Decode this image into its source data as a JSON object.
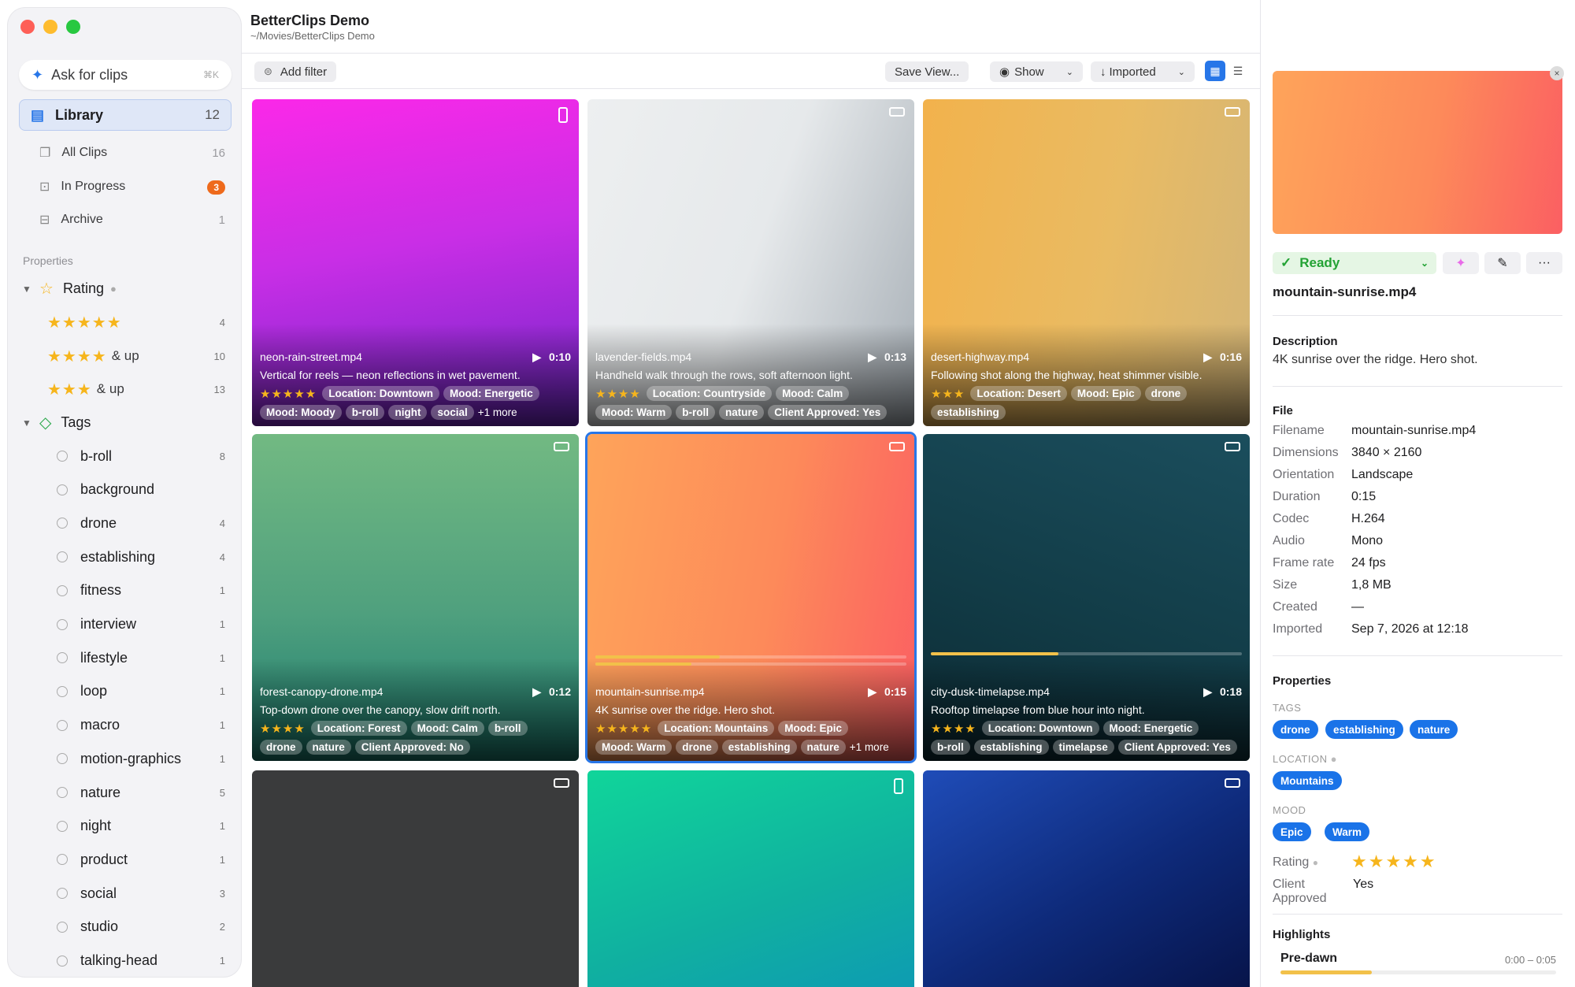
{
  "window": {
    "title": "BetterClips Demo",
    "path": "~/Movies/BetterClips Demo"
  },
  "sidebar": {
    "ask": {
      "label": "Ask for clips",
      "shortcut": "⌘K"
    },
    "library": {
      "label": "Library",
      "count": "12"
    },
    "items": [
      {
        "label": "All Clips",
        "count": "16"
      },
      {
        "label": "In Progress",
        "count": "3"
      },
      {
        "label": "Archive",
        "count": "1"
      }
    ],
    "properties_label": "Properties",
    "rating": {
      "label": "Rating",
      "rows": [
        {
          "stars": "★★★★★",
          "suffix": "",
          "count": "4"
        },
        {
          "stars": "★★★★",
          "suffix": "& up",
          "count": "10"
        },
        {
          "stars": "★★★",
          "suffix": "& up",
          "count": "13"
        }
      ]
    },
    "tags": {
      "label": "Tags",
      "rows": [
        {
          "label": "b-roll",
          "count": "8"
        },
        {
          "label": "background",
          "count": ""
        },
        {
          "label": "drone",
          "count": "4"
        },
        {
          "label": "establishing",
          "count": "4"
        },
        {
          "label": "fitness",
          "count": "1"
        },
        {
          "label": "interview",
          "count": "1"
        },
        {
          "label": "lifestyle",
          "count": "1"
        },
        {
          "label": "loop",
          "count": "1"
        },
        {
          "label": "macro",
          "count": "1"
        },
        {
          "label": "motion-graphics",
          "count": "1"
        },
        {
          "label": "nature",
          "count": "5"
        },
        {
          "label": "night",
          "count": "1"
        },
        {
          "label": "product",
          "count": "1"
        },
        {
          "label": "social",
          "count": "3"
        },
        {
          "label": "studio",
          "count": "2"
        },
        {
          "label": "talking-head",
          "count": "1"
        }
      ]
    }
  },
  "toolbar": {
    "add_filter": "Add filter",
    "save_view": "Save View...",
    "show": "Show",
    "sort": "Imported"
  },
  "clips": [
    {
      "name": "neon-rain-street.mp4",
      "duration": "0:10",
      "description": "Vertical for reels — neon reflections in wet pavement.",
      "stars": "★★★★★",
      "chips": [
        "Location: Downtown",
        "Mood: Energetic",
        "Mood: Moody",
        "b-roll",
        "night",
        "social"
      ],
      "more": "+1 more"
    },
    {
      "name": "lavender-fields.mp4",
      "duration": "0:13",
      "description": "Handheld walk through the rows, soft afternoon light.",
      "stars": "★★★★",
      "chips": [
        "Location: Countryside",
        "Mood: Calm",
        "Mood: Warm",
        "b-roll",
        "nature",
        "Client Approved: Yes"
      ],
      "more": ""
    },
    {
      "name": "desert-highway.mp4",
      "duration": "0:16",
      "description": "Following shot along the highway, heat shimmer visible.",
      "stars": "★★★",
      "chips": [
        "Location: Desert",
        "Mood: Epic",
        "drone",
        "establishing"
      ],
      "more": ""
    },
    {
      "name": "forest-canopy-drone.mp4",
      "duration": "0:12",
      "description": "Top-down drone over the canopy, slow drift north.",
      "stars": "★★★★",
      "chips": [
        "Location: Forest",
        "Mood: Calm",
        "b-roll",
        "drone",
        "nature",
        "Client Approved: No"
      ],
      "more": ""
    },
    {
      "name": "mountain-sunrise.mp4",
      "duration": "0:15",
      "description": "4K sunrise over the ridge. Hero shot.",
      "stars": "★★★★★",
      "chips": [
        "Location: Mountains",
        "Mood: Epic",
        "Mood: Warm",
        "drone",
        "establishing",
        "nature"
      ],
      "more": "+1 more"
    },
    {
      "name": "city-dusk-timelapse.mp4",
      "duration": "0:18",
      "description": "Rooftop timelapse from blue hour into night.",
      "stars": "★★★★",
      "chips": [
        "Location: Downtown",
        "Mood: Energetic",
        "b-roll",
        "establishing",
        "timelapse",
        "Client Approved: Yes"
      ],
      "more": ""
    }
  ],
  "inspector": {
    "status": "Ready",
    "filename_title": "mountain-sunrise.mp4",
    "description_label": "Description",
    "description": "4K sunrise over the ridge. Hero shot.",
    "file_label": "File",
    "file": [
      {
        "k": "Filename",
        "v": "mountain-sunrise.mp4"
      },
      {
        "k": "Dimensions",
        "v": "3840 × 2160"
      },
      {
        "k": "Orientation",
        "v": "Landscape"
      },
      {
        "k": "Duration",
        "v": "0:15"
      },
      {
        "k": "Codec",
        "v": "H.264"
      },
      {
        "k": "Audio",
        "v": "Mono"
      },
      {
        "k": "Frame rate",
        "v": "24 fps"
      },
      {
        "k": "Size",
        "v": "1,8 MB"
      },
      {
        "k": "Created",
        "v": "—"
      },
      {
        "k": "Imported",
        "v": "Sep 7, 2026 at 12:18"
      }
    ],
    "properties_label": "Properties",
    "tags_label": "TAGS",
    "tags": [
      "drone",
      "establishing",
      "nature"
    ],
    "location_label": "LOCATION",
    "location": [
      "Mountains"
    ],
    "mood_label": "MOOD",
    "mood": [
      "Epic",
      "Warm"
    ],
    "rating_label": "Rating",
    "rating_stars": "★★★★★",
    "approved_label": "Client Approved",
    "approved_value": "Yes",
    "highlights_label": "Highlights",
    "highlight": {
      "label": "Pre-dawn",
      "range": "0:00 – 0:05",
      "fraction": 0.33
    }
  },
  "colors": {
    "accent": "#1a73e8",
    "star": "#f6b51c",
    "ready": "#23a234",
    "badge": "#ee6a1c"
  }
}
